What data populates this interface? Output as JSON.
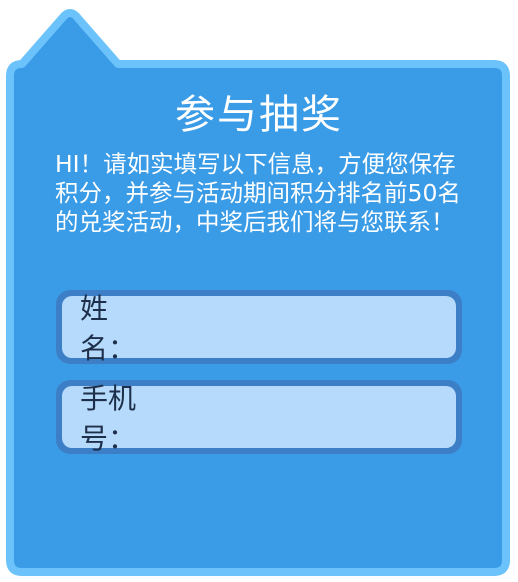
{
  "colors": {
    "panel_fill": "#3a9be6",
    "panel_border": "#6cc2fa",
    "field_border": "#3d7fc6",
    "field_fill": "#b6dafb",
    "label_text": "#1d2f4a"
  },
  "form": {
    "title": "参与抽奖",
    "description": "HI！请如实填写以下信息，方便您保存积分，并参与活动期间积分排名前50名的兑奖活动，中奖后我们将与您联系！",
    "fields": [
      {
        "label": "姓名：",
        "value": ""
      },
      {
        "label": "手机号：",
        "value": ""
      }
    ]
  }
}
